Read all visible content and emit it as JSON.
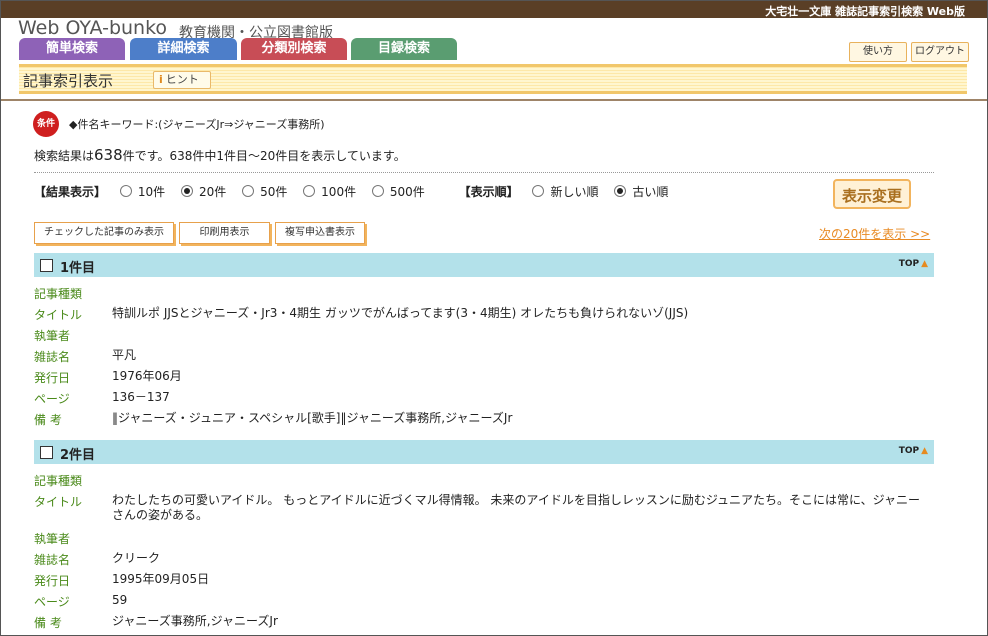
{
  "header": {
    "top_title": "大宅壮一文庫 雑誌記事索引検索 Web版",
    "logo": "Web OYA-bunko",
    "logo_sub": "教育機関・公立図書館版",
    "tabs": [
      "簡単検索",
      "詳細検索",
      "分類別検索",
      "目録検索"
    ],
    "help_label": "使い方",
    "login_label": "ログアウト"
  },
  "band": {
    "title": "記事索引表示",
    "hint_icon": "i",
    "hint_label": "ヒント"
  },
  "condition": {
    "icon_label": "条件",
    "text": "◆件名キーワード:(ジャニーズJr⇒ジャニーズ事務所)"
  },
  "result": {
    "prefix": "検索結果は",
    "count": "638",
    "suffix": "件です。638件中1件目〜20件目を表示しています。"
  },
  "options": {
    "count_label": "【結果表示】",
    "count_options": [
      "10件",
      "20件",
      "50件",
      "100件",
      "500件"
    ],
    "count_selected": 1,
    "order_label": "【表示順】",
    "order_options": [
      "新しい順",
      "古い順"
    ],
    "order_selected": 1,
    "change_button": "表示変更"
  },
  "actions": {
    "checked_only": "チェックした記事のみ表示",
    "print": "印刷用表示",
    "copy_request": "複写申込書表示",
    "next": "次の20件を表示 >>"
  },
  "field_labels": {
    "type": "記事種類",
    "title": "タイトル",
    "author": "執筆者",
    "magazine": "雑誌名",
    "date": "発行日",
    "page": "ページ",
    "note": "備 考"
  },
  "top_label": "TOP",
  "records": [
    {
      "no": "1件目",
      "type": "",
      "title": "特訓ルポ JJSとジャニーズ・Jr3・4期生 ガッツでがんばってます(3・4期生) オレたちも負けられないゾ(JJS)",
      "author": "",
      "magazine": "平凡",
      "date": "1976年06月",
      "page": "136－137",
      "note": "‖ジャニーズ・ジュニア・スペシャル[歌手]‖ジャニーズ事務所,ジャニーズJr"
    },
    {
      "no": "2件目",
      "type": "",
      "title": "わたしたちの可愛いアイドル。 もっとアイドルに近づくマル得情報。 未来のアイドルを目指しレッスンに励むジュニアたち。そこには常に、ジャニーさんの姿がある。",
      "author": "",
      "magazine": "クリーク",
      "date": "1995年09月05日",
      "page": "59",
      "note": "ジャニーズ事務所,ジャニーズJr"
    }
  ],
  "colors": {
    "top_bar": "#5a3f26",
    "tab_simple": "#8e62b7",
    "tab_detail": "#4d7ec9",
    "tab_category": "#c84d56",
    "tab_catalog": "#5a9d71",
    "record_header": "#b3e1ea",
    "field_label": "#4a8a1a",
    "accent": "#e88b25"
  }
}
